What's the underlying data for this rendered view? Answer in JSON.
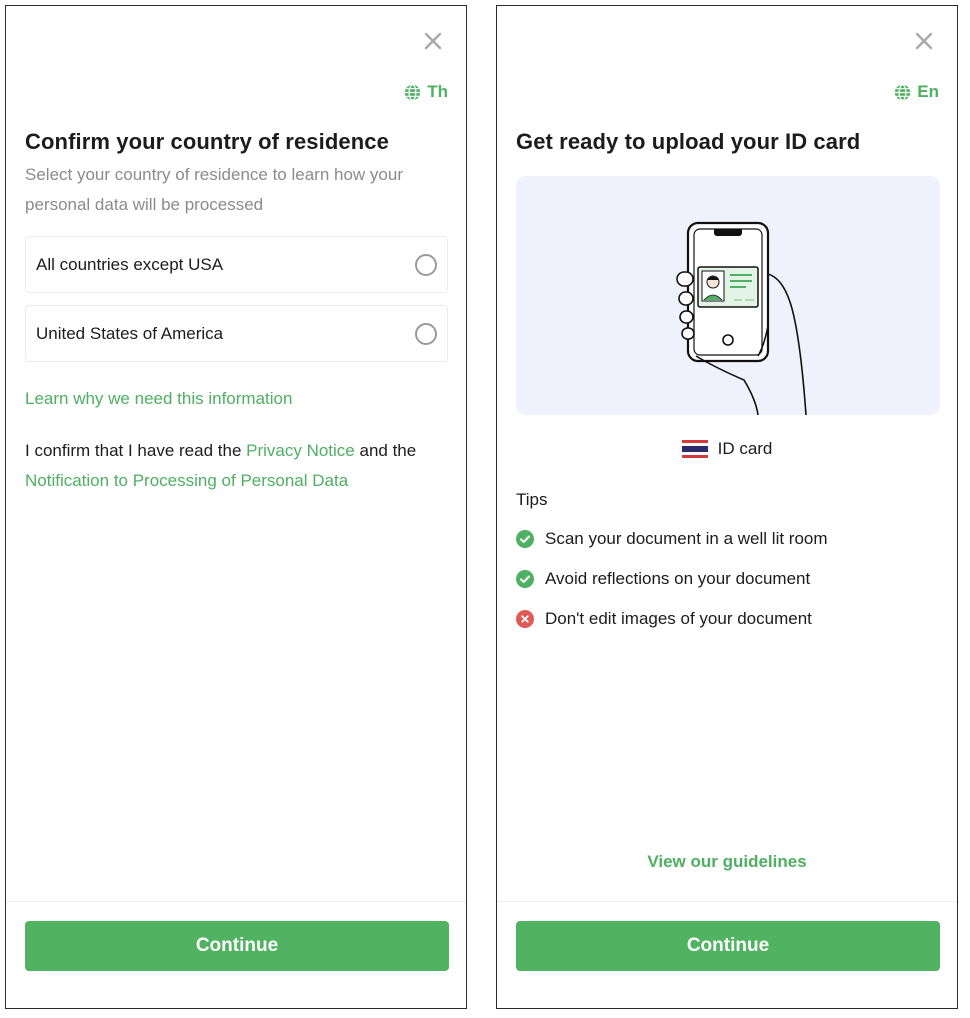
{
  "left": {
    "lang_label": "Th",
    "title": "Confirm your country of residence",
    "subtitle": "Select your country of residence to learn how your personal data will be processed",
    "options": [
      {
        "label": "All countries except USA",
        "selected": false
      },
      {
        "label": "United States of America",
        "selected": false
      }
    ],
    "learn_link": "Learn why we need this information",
    "confirm_prefix": "I confirm that I have read the ",
    "privacy_link": "Privacy Notice",
    "confirm_mid": " and the ",
    "notification_link": "Notification to Processing of Personal Data",
    "continue_label": "Continue"
  },
  "right": {
    "lang_label": "En",
    "title": "Get ready to upload your ID card",
    "document_label": "ID card",
    "tips_title": "Tips",
    "tips": [
      {
        "text": "Scan your document in a well lit room",
        "status": "good"
      },
      {
        "text": "Avoid reflections on your document",
        "status": "good"
      },
      {
        "text": "Don't edit images of your document",
        "status": "bad"
      }
    ],
    "guidelines_link": "View our guidelines",
    "continue_label": "Continue"
  },
  "colors": {
    "accent": "#4faf63",
    "button": "#51b262",
    "error": "#e05a55",
    "illustration_bg": "#eff1fd"
  },
  "icons": {
    "close": "close-icon",
    "language": "globe-icon",
    "radio": "radio-unchecked-icon",
    "flag": "thailand-flag-icon",
    "tip_good": "check-circle-icon",
    "tip_bad": "x-circle-icon"
  }
}
